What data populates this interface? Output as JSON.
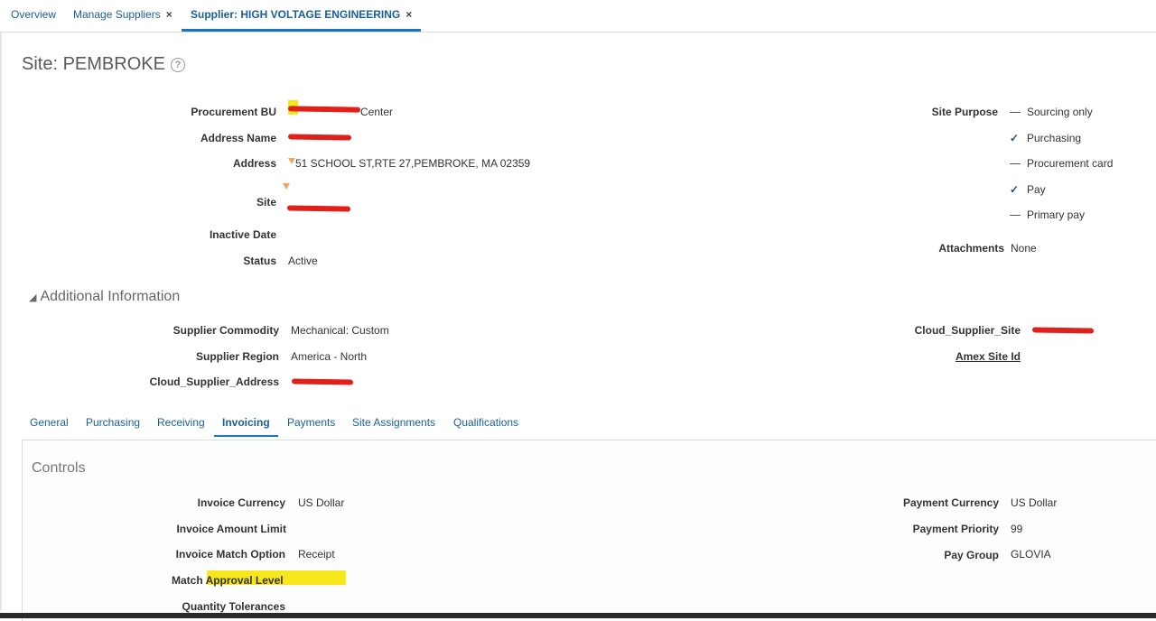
{
  "tabs": [
    {
      "label": "Overview"
    },
    {
      "label": "Manage Suppliers",
      "close": "×"
    },
    {
      "label": "Supplier: HIGH VOLTAGE ENGINEERING",
      "close": "×"
    }
  ],
  "page": {
    "title": "Site: PEMBROKE",
    "help_glyph": "?"
  },
  "site_fields": {
    "procurement_bu": {
      "label": "Procurement BU",
      "value": "Center"
    },
    "address_name": {
      "label": "Address Name",
      "value": ""
    },
    "address": {
      "label": "Address",
      "value": "51 SCHOOL ST,RTE 27,PEMBROKE, MA 02359"
    },
    "site": {
      "label": "Site",
      "value": ""
    },
    "inactive_date": {
      "label": "Inactive Date",
      "value": ""
    },
    "status": {
      "label": "Status",
      "value": "Active"
    }
  },
  "site_purpose": {
    "label": "Site Purpose",
    "items": [
      {
        "label": "Sourcing only",
        "checked": false
      },
      {
        "label": "Purchasing",
        "checked": true
      },
      {
        "label": "Procurement card",
        "checked": false
      },
      {
        "label": "Pay",
        "checked": true
      },
      {
        "label": "Primary pay",
        "checked": false
      }
    ],
    "check_glyph": "✓"
  },
  "attachments": {
    "label": "Attachments",
    "value": "None"
  },
  "additional_info": {
    "title": "Additional Information",
    "supplier_commodity": {
      "label": "Supplier Commodity",
      "value": "Mechanical: Custom"
    },
    "supplier_region": {
      "label": "Supplier Region",
      "value": "America - North"
    },
    "cloud_supplier_address": {
      "label": "Cloud_Supplier_Address",
      "value": ""
    },
    "cloud_supplier_site": {
      "label": "Cloud_Supplier_Site",
      "value": ""
    },
    "amex_site_id": {
      "label": "Amex Site Id",
      "value": ""
    }
  },
  "subtabs": [
    "General",
    "Purchasing",
    "Receiving",
    "Invoicing",
    "Payments",
    "Site Assignments",
    "Qualifications"
  ],
  "controls": {
    "title": "Controls",
    "invoice_currency": {
      "label": "Invoice Currency",
      "value": "US Dollar"
    },
    "invoice_amount_limit": {
      "label": "Invoice Amount Limit",
      "value": ""
    },
    "invoice_match_option": {
      "label": "Invoice Match Option",
      "value": "Receipt"
    },
    "match_approval_level": {
      "label_a": "Match ",
      "label_b": "Approval Level",
      "value": ""
    },
    "quantity_tolerances": {
      "label": "Quantity Tolerances",
      "value": ""
    },
    "payment_currency": {
      "label": "Payment Currency",
      "value": "US Dollar"
    },
    "payment_priority": {
      "label": "Payment Priority",
      "value": "99"
    },
    "pay_group": {
      "label": "Pay Group",
      "value": "GLOVIA"
    }
  },
  "colors": {
    "link": "#1a5e9a",
    "redaction": "#e0201b",
    "highlight": "#f5e71b"
  }
}
